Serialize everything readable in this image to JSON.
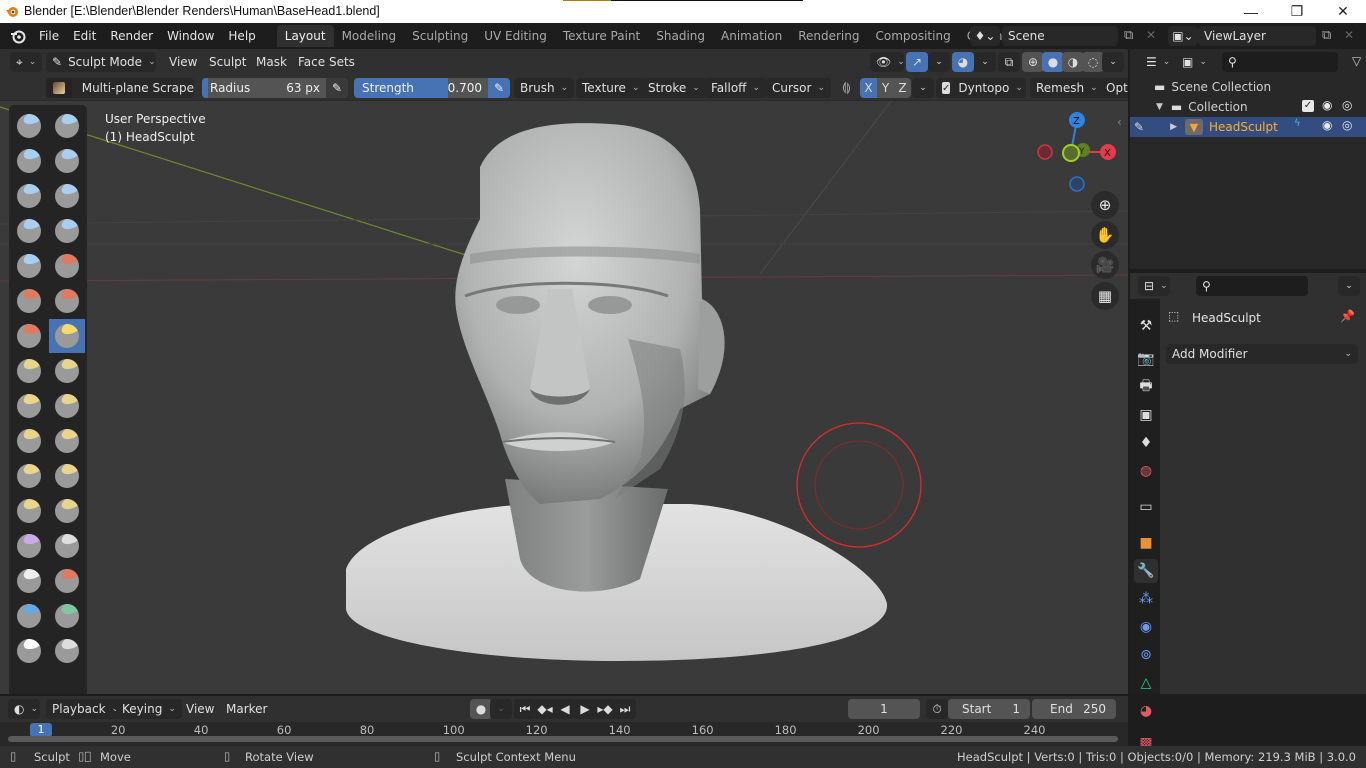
{
  "window": {
    "title": "Blender [E:\\Blender\\Blender Renders\\Human\\BaseHead1.blend]",
    "controls": [
      "minimize",
      "maximize",
      "close"
    ],
    "control_glyphs": {
      "minimize": "—",
      "maximize": "❐",
      "close": "✕"
    }
  },
  "menubar": {
    "items": [
      "File",
      "Edit",
      "Render",
      "Window",
      "Help"
    ],
    "workspaces": [
      "Layout",
      "Modeling",
      "Sculpting",
      "UV Editing",
      "Texture Paint",
      "Shading",
      "Animation",
      "Rendering",
      "Compositing",
      "Geometry Nod"
    ],
    "active_workspace": "Layout",
    "scene": "Scene",
    "view_layer": "ViewLayer"
  },
  "viewport_header": {
    "mode": "Sculpt Mode",
    "menus": [
      "View",
      "Sculpt",
      "Mask",
      "Face Sets"
    ],
    "brush_name": "Multi-plane Scrape",
    "radius": {
      "label": "Radius",
      "value": "63 px",
      "fill": 0.05
    },
    "strength": {
      "label": "Strength",
      "value": "0.700",
      "fill": 0.7
    },
    "dropdowns": [
      "Brush",
      "Texture",
      "Stroke",
      "Falloff",
      "Cursor"
    ],
    "symmetry": [
      "X",
      "Y",
      "Z"
    ],
    "symmetry_active": "X",
    "dyntopo": {
      "label": "Dyntopo",
      "checked": true
    },
    "remesh": "Remesh",
    "options": "Opt",
    "shading_modes": [
      "wireframe",
      "solid",
      "material",
      "rendered"
    ],
    "active_shading": "solid"
  },
  "viewport": {
    "perspective_label": "User Perspective",
    "object_label": "(1) HeadSculpt",
    "gizmo": {
      "x": "X",
      "y": "Y",
      "z": "Z"
    },
    "nav_buttons": [
      "zoom",
      "pan",
      "camera",
      "ortho-grid"
    ]
  },
  "outliner": {
    "search_placeholder": "",
    "items": [
      {
        "label": "Scene Collection",
        "type": "scene-collection"
      },
      {
        "label": "Collection",
        "type": "collection",
        "checked": true
      },
      {
        "label": "HeadSculpt",
        "type": "mesh",
        "selected": true
      }
    ]
  },
  "properties": {
    "object_name": "HeadSculpt",
    "add_modifier": "Add Modifier",
    "tabs": [
      "tool",
      "render",
      "output",
      "view-layer",
      "scene",
      "world",
      "collection",
      "object",
      "modifiers",
      "particles",
      "physics",
      "constraints",
      "data",
      "material",
      "texture"
    ],
    "active_tab": "modifiers"
  },
  "timeline": {
    "menus": [
      "Playback",
      "Keying",
      "View",
      "Marker"
    ],
    "current_frame": "1",
    "start_label": "Start",
    "start": "1",
    "end_label": "End",
    "end": "250",
    "ruler": [
      "1",
      "20",
      "40",
      "60",
      "80",
      "100",
      "120",
      "140",
      "160",
      "180",
      "200",
      "220",
      "240"
    ]
  },
  "statusbar": {
    "hints": [
      {
        "icon": "mouse-left",
        "label": "Sculpt"
      },
      {
        "icon": "mouse-drag",
        "label": "Move"
      },
      {
        "icon": "mouse-middle",
        "label": "Rotate View"
      },
      {
        "icon": "mouse-right",
        "label": "Sculpt Context Menu"
      }
    ],
    "stats": "HeadSculpt | Verts:0 | Tris:0 | Objects:0/0 | Memory: 219.3 MiB | 3.0.0"
  },
  "colors": {
    "accent": "#4772b3",
    "selected_text": "#ffaf29",
    "axis_x": "#e5394c",
    "axis_y": "#7fb31f",
    "axis_z": "#2f83e3",
    "brush_circle": "#e02a2a"
  }
}
